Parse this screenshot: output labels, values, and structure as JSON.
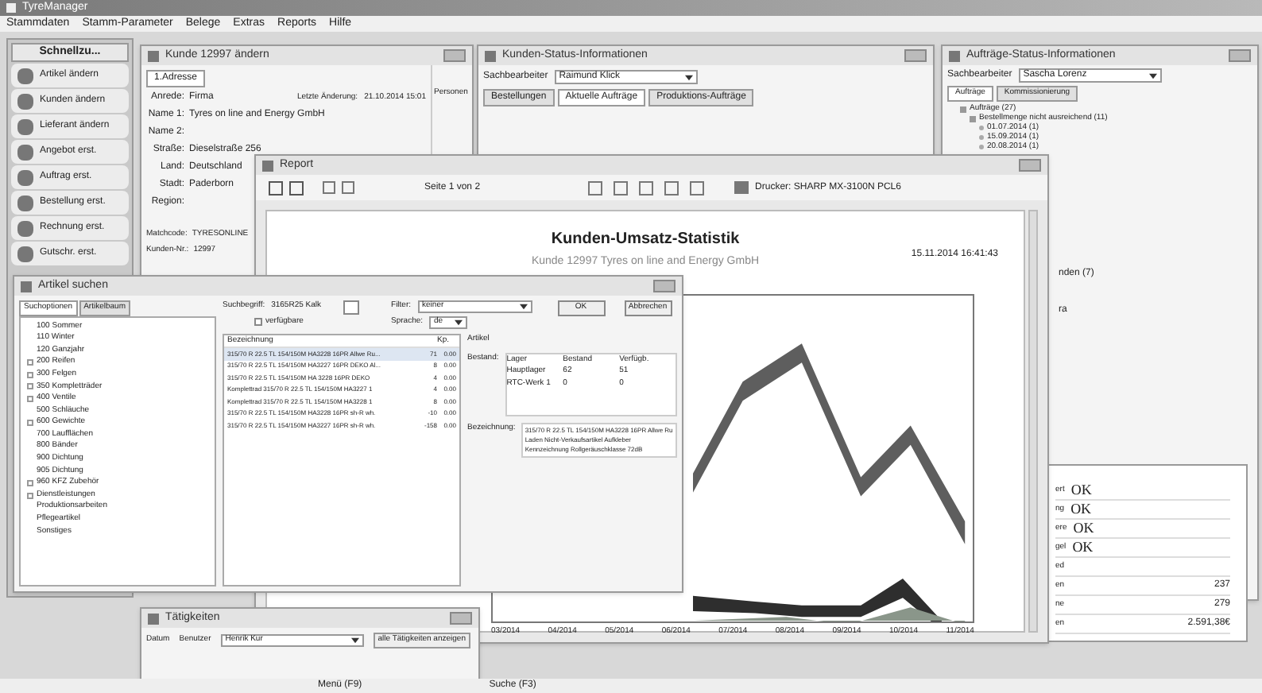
{
  "app": {
    "title": "TyreManager",
    "menu": [
      "Stammdaten",
      "Stamm-Parameter",
      "Belege",
      "Extras",
      "Reports",
      "Hilfe"
    ]
  },
  "sidebar": {
    "title": "Schnellzu...",
    "items": [
      "Artikel ändern",
      "Kunden ändern",
      "Lieferant ändern",
      "Angebot erst.",
      "Auftrag erst.",
      "Bestellung erst.",
      "Rechnung erst.",
      "Gutschr. erst."
    ]
  },
  "customer": {
    "title": "Kunde 12997 ändern",
    "tab": "1.Adresse",
    "side_label": "Personen",
    "fields": [
      {
        "label": "Anrede:",
        "value": "Firma"
      },
      {
        "label": "Name 1:",
        "value": "Tyres on line and Energy GmbH"
      },
      {
        "label": "Name 2:"
      },
      {
        "label": "Straße:",
        "value": "Dieselstraße 256"
      },
      {
        "label": "Land:",
        "value": "Deutschland"
      },
      {
        "label": "Stadt:",
        "value": "Paderborn"
      },
      {
        "label": "Region:"
      }
    ],
    "changed_label": "Letzte Änderung:",
    "changed_value": "21.10.2014 15:01",
    "matchcode_label": "Matchcode:",
    "matchcode_value": "TYRESONLINE",
    "number_label": "Kunden-Nr.:",
    "number_value": "12997"
  },
  "customer_status": {
    "title": "Kunden-Status-Informationen",
    "clerk_label": "Sachbearbeiter",
    "clerk": "Raimund Klick",
    "tabs": [
      {
        "label": "Bestellungen",
        "selected": false
      },
      {
        "label": "Aktuelle Aufträge",
        "selected": true
      },
      {
        "label": "Produktions-Aufträge",
        "selected": false
      }
    ]
  },
  "order_status": {
    "title": "Aufträge-Status-Informationen",
    "clerk_label": "Sachbearbeiter",
    "clerk": "Sascha Lorenz",
    "tabs": [
      {
        "label": "Aufträge",
        "selected": true
      },
      {
        "label": "Kommissionierung",
        "selected": false
      }
    ],
    "tree": [
      {
        "label": "Aufträge (27)",
        "expanded": true,
        "children": [
          {
            "label": "Bestellmenge nicht ausreichend (11)",
            "expanded": true,
            "children": [
              {
                "label": "01.07.2014 (1)"
              },
              {
                "label": "15.09.2014 (1)"
              },
              {
                "label": "20.08.2014 (1)"
              }
            ]
          }
        ]
      }
    ],
    "partial": [
      "nden (7)",
      "ra"
    ]
  },
  "status_panel": {
    "rows": [
      {
        "label": "ert",
        "value": "OK",
        "kind": "status"
      },
      {
        "label": "ng",
        "value": "OK",
        "kind": "status"
      },
      {
        "label": "ere",
        "value": "OK",
        "kind": "status"
      },
      {
        "label": "gel",
        "value": "OK",
        "kind": "status"
      },
      {
        "label": "ed",
        "kind": "number"
      },
      {
        "label": "en",
        "value": "237",
        "kind": "number"
      },
      {
        "label": "ne",
        "value": "279",
        "kind": "number"
      },
      {
        "label": "en",
        "value": "2.591,38€",
        "kind": "number"
      }
    ]
  },
  "report": {
    "title": "Report",
    "page": "Seite 1 von 2",
    "printer": "Drucker: SHARP MX-3100N PCL6",
    "heading": "Kunden-Umsatz-Statistik",
    "subheading": "Kunde 12997 Tyres on line and Energy GmbH",
    "timestamp": "15.11.2014 16:41:43",
    "x_labels": [
      "03/2014",
      "04/2014",
      "05/2014",
      "06/2014",
      "07/2014",
      "08/2014",
      "09/2014",
      "10/2014",
      "11/2014"
    ]
  },
  "article_search": {
    "title": "Artikel suchen",
    "tabs": [
      {
        "label": "Suchoptionen",
        "selected": true
      },
      {
        "label": "Artikelbaum",
        "selected": false
      }
    ],
    "tree": [
      {
        "label": "100 Sommer",
        "expandable": false
      },
      {
        "label": "110 Winter",
        "expandable": false
      },
      {
        "label": "120 Ganzjahr",
        "expandable": false
      },
      {
        "label": "200 Reifen",
        "expandable": true
      },
      {
        "label": "300 Felgen",
        "expandable": true
      },
      {
        "label": "350 Kompletträder",
        "expandable": true
      },
      {
        "label": "400 Ventile",
        "expandable": true
      },
      {
        "label": "500 Schläuche",
        "expandable": false
      },
      {
        "label": "600 Gewichte",
        "expandable": true
      },
      {
        "label": "700 Laufflächen",
        "expandable": false
      },
      {
        "label": "800 Bänder",
        "expandable": false
      },
      {
        "label": "900 Dichtung",
        "expandable": false
      },
      {
        "label": "905 Dichtung",
        "expandable": false
      },
      {
        "label": "960 KFZ Zubehör",
        "expandable": true
      },
      {
        "label": "Dienstleistungen",
        "expandable": true
      },
      {
        "label": "Produktionsarbeiten",
        "expandable": false
      },
      {
        "label": "Pflegeartikel",
        "expandable": false
      },
      {
        "label": "Sonstiges",
        "expandable": false
      }
    ],
    "search_label": "Suchbegriff:",
    "search_value": "3165R25 Kalk",
    "only_available": {
      "label": "verfügbare",
      "checked": false
    },
    "filter_label": "Filter:",
    "filter_value": "keiner",
    "language_label": "Sprache:",
    "language_value": "de",
    "ok": "OK",
    "cancel": "Abbrechen",
    "columns": [
      "Bezeichnung",
      "Kp."
    ],
    "rows": [
      {
        "name": "315/70 R 22.5 TL 154/150M HA3228 16PR Allwe Ru...",
        "qty": "71",
        "price": "0.00",
        "selected": true
      },
      {
        "name": "315/70 R 22.5 TL 154/150M HA3227 16PR DEKO Al...",
        "qty": "8",
        "price": "0.00",
        "selected": false
      },
      {
        "name": "315/70 R 22.5 TL 154/150M HA 3228 16PR DEKO",
        "qty": "4",
        "price": "0.00",
        "selected": false
      },
      {
        "name": "Komplettrad 315/70 R 22.5 TL 154/150M HA3227 1",
        "qty": "4",
        "price": "0.00",
        "selected": false
      },
      {
        "name": "Komplettrad 315/70 R 22.5 TL 154/150M HA3228 1",
        "qty": "8",
        "price": "0.00",
        "selected": false
      },
      {
        "name": "315/70 R 22.5 TL 154/150M HA3228 16PR sh-R wh.",
        "qty": "-10",
        "price": "0.00",
        "selected": false
      },
      {
        "name": "315/70 R 22.5 TL 154/150M HA3227 16PR sh-R wh.",
        "qty": "-158",
        "price": "0.00",
        "selected": false
      }
    ],
    "detail_title": "Artikel",
    "stock_label": "Bestand:",
    "stock_columns": [
      "Lager",
      "Bestand",
      "Verfügb."
    ],
    "stock_rows": [
      [
        "Hauptlager",
        "62",
        "51"
      ],
      [
        "RTC-Werk 1",
        "0",
        "0"
      ]
    ],
    "description_label": "Bezeichnung:",
    "description": "315/70 R 22.5 TL 154/150M HA3228 16PR Allwe Ru Laden Nicht-Verkaufsartikel Aufkleber Kennzeichnung Rollgeräuschklasse 72dB"
  },
  "activities": {
    "title": "Tätigkeiten",
    "date_label": "Datum",
    "user_label": "Benutzer",
    "user_value": "Henrik Kur",
    "show_all": "alle Tätigkeiten anzeigen"
  },
  "status_bar": [
    "Menü (F9)",
    "Suche (F3)"
  ]
}
